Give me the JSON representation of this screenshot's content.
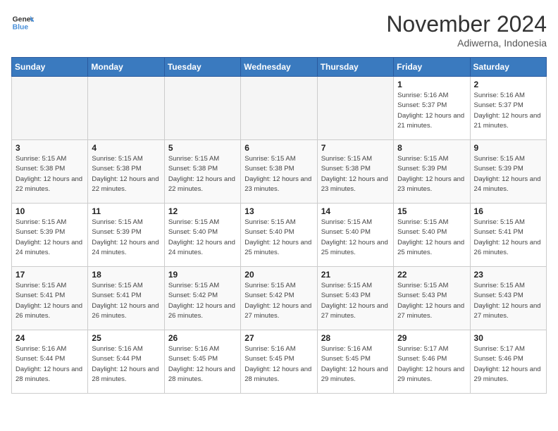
{
  "header": {
    "logo_line1": "General",
    "logo_line2": "Blue",
    "month_title": "November 2024",
    "location": "Adiwerna, Indonesia"
  },
  "days_of_week": [
    "Sunday",
    "Monday",
    "Tuesday",
    "Wednesday",
    "Thursday",
    "Friday",
    "Saturday"
  ],
  "weeks": [
    [
      {
        "day": "",
        "empty": true
      },
      {
        "day": "",
        "empty": true
      },
      {
        "day": "",
        "empty": true
      },
      {
        "day": "",
        "empty": true
      },
      {
        "day": "",
        "empty": true
      },
      {
        "day": "1",
        "sunrise": "5:16 AM",
        "sunset": "5:37 PM",
        "daylight": "12 hours and 21 minutes."
      },
      {
        "day": "2",
        "sunrise": "5:16 AM",
        "sunset": "5:37 PM",
        "daylight": "12 hours and 21 minutes."
      }
    ],
    [
      {
        "day": "3",
        "sunrise": "5:15 AM",
        "sunset": "5:38 PM",
        "daylight": "12 hours and 22 minutes."
      },
      {
        "day": "4",
        "sunrise": "5:15 AM",
        "sunset": "5:38 PM",
        "daylight": "12 hours and 22 minutes."
      },
      {
        "day": "5",
        "sunrise": "5:15 AM",
        "sunset": "5:38 PM",
        "daylight": "12 hours and 22 minutes."
      },
      {
        "day": "6",
        "sunrise": "5:15 AM",
        "sunset": "5:38 PM",
        "daylight": "12 hours and 23 minutes."
      },
      {
        "day": "7",
        "sunrise": "5:15 AM",
        "sunset": "5:38 PM",
        "daylight": "12 hours and 23 minutes."
      },
      {
        "day": "8",
        "sunrise": "5:15 AM",
        "sunset": "5:39 PM",
        "daylight": "12 hours and 23 minutes."
      },
      {
        "day": "9",
        "sunrise": "5:15 AM",
        "sunset": "5:39 PM",
        "daylight": "12 hours and 24 minutes."
      }
    ],
    [
      {
        "day": "10",
        "sunrise": "5:15 AM",
        "sunset": "5:39 PM",
        "daylight": "12 hours and 24 minutes."
      },
      {
        "day": "11",
        "sunrise": "5:15 AM",
        "sunset": "5:39 PM",
        "daylight": "12 hours and 24 minutes."
      },
      {
        "day": "12",
        "sunrise": "5:15 AM",
        "sunset": "5:40 PM",
        "daylight": "12 hours and 24 minutes."
      },
      {
        "day": "13",
        "sunrise": "5:15 AM",
        "sunset": "5:40 PM",
        "daylight": "12 hours and 25 minutes."
      },
      {
        "day": "14",
        "sunrise": "5:15 AM",
        "sunset": "5:40 PM",
        "daylight": "12 hours and 25 minutes."
      },
      {
        "day": "15",
        "sunrise": "5:15 AM",
        "sunset": "5:40 PM",
        "daylight": "12 hours and 25 minutes."
      },
      {
        "day": "16",
        "sunrise": "5:15 AM",
        "sunset": "5:41 PM",
        "daylight": "12 hours and 26 minutes."
      }
    ],
    [
      {
        "day": "17",
        "sunrise": "5:15 AM",
        "sunset": "5:41 PM",
        "daylight": "12 hours and 26 minutes."
      },
      {
        "day": "18",
        "sunrise": "5:15 AM",
        "sunset": "5:41 PM",
        "daylight": "12 hours and 26 minutes."
      },
      {
        "day": "19",
        "sunrise": "5:15 AM",
        "sunset": "5:42 PM",
        "daylight": "12 hours and 26 minutes."
      },
      {
        "day": "20",
        "sunrise": "5:15 AM",
        "sunset": "5:42 PM",
        "daylight": "12 hours and 27 minutes."
      },
      {
        "day": "21",
        "sunrise": "5:15 AM",
        "sunset": "5:43 PM",
        "daylight": "12 hours and 27 minutes."
      },
      {
        "day": "22",
        "sunrise": "5:15 AM",
        "sunset": "5:43 PM",
        "daylight": "12 hours and 27 minutes."
      },
      {
        "day": "23",
        "sunrise": "5:15 AM",
        "sunset": "5:43 PM",
        "daylight": "12 hours and 27 minutes."
      }
    ],
    [
      {
        "day": "24",
        "sunrise": "5:16 AM",
        "sunset": "5:44 PM",
        "daylight": "12 hours and 28 minutes."
      },
      {
        "day": "25",
        "sunrise": "5:16 AM",
        "sunset": "5:44 PM",
        "daylight": "12 hours and 28 minutes."
      },
      {
        "day": "26",
        "sunrise": "5:16 AM",
        "sunset": "5:45 PM",
        "daylight": "12 hours and 28 minutes."
      },
      {
        "day": "27",
        "sunrise": "5:16 AM",
        "sunset": "5:45 PM",
        "daylight": "12 hours and 28 minutes."
      },
      {
        "day": "28",
        "sunrise": "5:16 AM",
        "sunset": "5:45 PM",
        "daylight": "12 hours and 29 minutes."
      },
      {
        "day": "29",
        "sunrise": "5:17 AM",
        "sunset": "5:46 PM",
        "daylight": "12 hours and 29 minutes."
      },
      {
        "day": "30",
        "sunrise": "5:17 AM",
        "sunset": "5:46 PM",
        "daylight": "12 hours and 29 minutes."
      }
    ]
  ]
}
